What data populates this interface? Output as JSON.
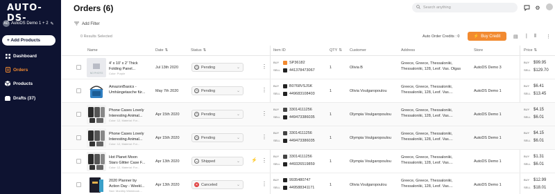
{
  "brand": {
    "logo_text": "AUTO-DS-"
  },
  "store_switcher": {
    "avatar": "AD",
    "name": "AutoDS Demo 1 + 2"
  },
  "sidebar": {
    "add_products": "+ Add Products",
    "items": [
      {
        "label": "Dashboard",
        "icon": "grid-icon",
        "active": false
      },
      {
        "label": "Orders",
        "icon": "orders-icon",
        "active": true
      },
      {
        "label": "Products",
        "icon": "box-icon",
        "active": false
      },
      {
        "label": "Drafts (37)",
        "icon": "drafts-icon",
        "active": false
      }
    ]
  },
  "header": {
    "title": "Orders (6)",
    "search_placeholder": "Search anything"
  },
  "toolbar": {
    "add_filter": "Add Filter",
    "results_selected": "0 Results Selected",
    "credits": "Auto Order Credits : 0",
    "buy_credit": "Buy Credit"
  },
  "columns": {
    "name": "Name",
    "date": "Date",
    "status": "Status",
    "item_id": "Item ID",
    "qty": "QTY",
    "customer": "Customer",
    "address": "Address",
    "store": "Store",
    "price": "Price"
  },
  "colors": {
    "sidebar": "#0e1331",
    "accent": "#f28a30",
    "canceled": "#e04040"
  },
  "rows": [
    {
      "name_line1": "4' x 10' x 2' Thick",
      "name_line2": "Folding Panel...",
      "sub": "Color: Purple",
      "thumb": "placeholder",
      "date": "Jul 13th 2020",
      "status": "Pending",
      "status_icon": "clock-icon",
      "buy_id": "SP36182",
      "sell_id": "441378473067",
      "buy_src": "orange",
      "sell_src": "black",
      "qty": "1",
      "customer": "Olivia B",
      "address1": "Greece, Greece, Thessaloniki,",
      "address2": "Thessaloniki, 128, Leof. Vas. Olgas",
      "store": "AutoDS Demo 3",
      "buy_price": "$99.95",
      "sell_price": "$129.70",
      "flag": false
    },
    {
      "name_line1": "AmazonBasics -",
      "name_line2": "Umhängetasche für...",
      "sub": "",
      "thumb": "bag",
      "date": "May 7th 2020",
      "status": "Pending",
      "status_icon": "clock-icon",
      "buy_id": "B0768VSJSK",
      "sell_id": "449683108403",
      "buy_src": "black",
      "sell_src": "black",
      "qty": "1",
      "customer": "Olivia Voulgaropoulou",
      "address1": "Greece, Greece, Thessaloniki,",
      "address2": "Thessaloniki, 128, Leof. Vas....",
      "store": "AutoDS Demo 1",
      "buy_price": "$6.41",
      "sell_price": "$13.45",
      "flag": false
    },
    {
      "name_line1": "Phone Cases Lovely",
      "name_line2": "Interesting Animal...",
      "sub": "Color: 12, Material: For...",
      "thumb": "case",
      "date": "Apr 15th 2020",
      "status": "Pending",
      "status_icon": "clock-icon",
      "buy_id": "33014111256",
      "sell_id": "449473386035",
      "buy_src": "mail",
      "sell_src": "black",
      "qty": "1",
      "customer": "Olympia Voulgaropoulou",
      "address1": "Greece, Greece, Thessaloniki,",
      "address2": "Thessaloniki, 128, Leof. Vas....",
      "store": "AutoDS Demo 1",
      "buy_price": "$4.15",
      "sell_price": "$6.01",
      "flag": false
    },
    {
      "name_line1": "Phone Cases Lovely",
      "name_line2": "Interesting Animal...",
      "sub": "Color: 12, Material: For...",
      "thumb": "case",
      "date": "Apr 15th 2020",
      "status": "Pending",
      "status_icon": "clock-icon",
      "buy_id": "33014111256",
      "sell_id": "449473386035",
      "buy_src": "mail",
      "sell_src": "black",
      "qty": "1",
      "customer": "Olympia Voulgaropoulou",
      "address1": "Greece, Greece, Thessaloniki,",
      "address2": "Thessaloniki, 128, Leof. Vas....",
      "store": "AutoDS Demo 1",
      "buy_price": "$4.15",
      "sell_price": "$6.01",
      "flag": false
    },
    {
      "name_line1": "Hot Planet Moon",
      "name_line2": "Stars Glitter Case F...",
      "sub": "Color: 12, Material: For...",
      "thumb": "case",
      "date": "Apr 13th 2020",
      "status": "Shipped",
      "status_icon": "truck-icon",
      "buy_id": "33014111256",
      "sell_id": "449326519859",
      "buy_src": "mail",
      "sell_src": "black",
      "qty": "1",
      "customer": "Olympia Voulgaropoulou",
      "address1": "Greece, Greece, Thessaloniki,",
      "address2": "Thessaloniki, 128, Leof. Vas....",
      "store": "AutoDS Demo 1",
      "buy_price": "$1.31",
      "sell_price": "$6.01",
      "flag": true
    },
    {
      "name_line1": "2020 Planner by",
      "name_line2": "Action Day - Weekl...",
      "sub": "Size: Monthly Weekbook ...",
      "thumb": "planner",
      "date": "Apr 13th 2020",
      "status": "Canceled",
      "status_icon": "x-icon",
      "buy_id": "9935480747",
      "sell_id": "449588341171",
      "buy_src": "black",
      "sell_src": "black",
      "qty": "1",
      "customer": "Olivia Voulgaropoulou",
      "address1": "Greece, Greece, Thessaloniki,",
      "address2": "Thessaloniki, 128, Leof. Vas....",
      "store": "AutoDS Demo 1",
      "buy_price": "$12.99",
      "sell_price": "$18.01",
      "flag": false
    }
  ]
}
